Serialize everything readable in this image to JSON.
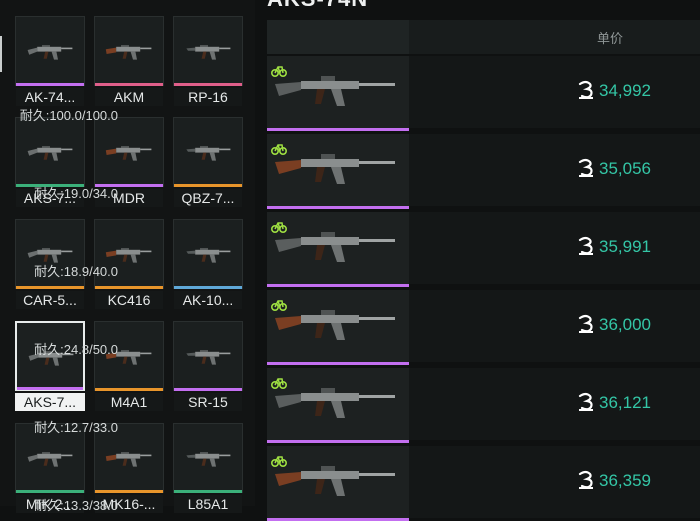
{
  "market": {
    "title": "AKS-74N",
    "column_price": "单价"
  },
  "colors": {
    "purple": "#c36ff0",
    "pink": "#e05f8a",
    "orange": "#e8952b",
    "green": "#3bb07a",
    "blue": "#5fa8d8",
    "price": "#34c6a6",
    "icon_green": "#9fe042"
  },
  "weapons": [
    {
      "label": "AK-74...",
      "rarity": "purple"
    },
    {
      "label": "AKM",
      "rarity": "pink"
    },
    {
      "label": "RP-16",
      "rarity": "pink"
    },
    {
      "label": "AKS-7...",
      "rarity": "green"
    },
    {
      "label": "MDR",
      "rarity": "purple"
    },
    {
      "label": "QBZ-7...",
      "rarity": "orange"
    },
    {
      "label": "CAR-5...",
      "rarity": "orange"
    },
    {
      "label": "KC416",
      "rarity": "orange"
    },
    {
      "label": "AK-10...",
      "rarity": "blue"
    },
    {
      "label": "AKS-7...",
      "rarity": "purple",
      "selected": true
    },
    {
      "label": "M4A1",
      "rarity": "orange"
    },
    {
      "label": "SR-15",
      "rarity": "purple"
    },
    {
      "label": "MIK 2...",
      "rarity": "green"
    },
    {
      "label": "MK16-...",
      "rarity": "orange"
    },
    {
      "label": "L85A1",
      "rarity": "green"
    }
  ],
  "listings": [
    {
      "durability": "耐久:100.0/100.0",
      "price": "34,992",
      "icon": "bike-icon"
    },
    {
      "durability": "耐久:19.0/34.0",
      "price": "35,056",
      "icon": "bike-icon"
    },
    {
      "durability": "耐久:18.9/40.0",
      "price": "35,991",
      "icon": "bike-icon"
    },
    {
      "durability": "耐久:24.8/50.0",
      "price": "36,000",
      "icon": "bike-icon"
    },
    {
      "durability": "耐久:12.7/33.0",
      "price": "36,121",
      "icon": "bike-icon"
    },
    {
      "durability": "耐久:13.3/38.0",
      "price": "36,359",
      "icon": "bike-icon"
    }
  ]
}
